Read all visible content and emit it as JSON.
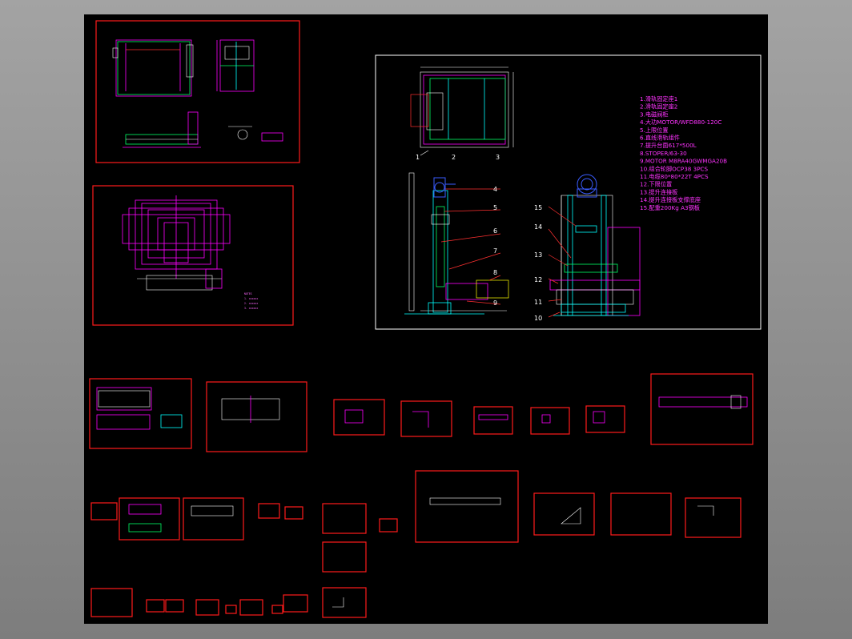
{
  "colors": {
    "background": "#8c8c8c",
    "canvas": "#000000",
    "frame": "#ff1a1a",
    "assembly_frame": "#ffffff",
    "notes": "#ff33ff",
    "part_lines": "#00ffff",
    "motor": "#3a5cff"
  },
  "assembly": {
    "bom": [
      "1.滑轨固定座1",
      "2.滑轨固定座2",
      "3.电磁阀柜",
      "4.大功MOTOR/WFD880-120C",
      "5.上限位置",
      "6.直线滑轨组件",
      "7.提升台面617*500L",
      "8.STOPER/63-30",
      "9.MOTOR M8RA40GWMGA20B",
      "10.组合轮脚OCP38 3PCS",
      "11.电缆80*80*22T 4PCS",
      "12.下限位置",
      "13.提升连接板",
      "14.提升连接板支撑底座",
      "15.配重200Kg A3钢板"
    ],
    "balloons_top": [
      "1",
      "2",
      "3"
    ],
    "balloons_side": [
      "4",
      "5",
      "6",
      "7",
      "8",
      "9"
    ],
    "balloons_front": [
      "15",
      "14",
      "13",
      "12",
      "11",
      "10"
    ]
  },
  "icons": {
    "motor": "motor-symbol-icon",
    "wheel": "caster-wheel-icon"
  }
}
